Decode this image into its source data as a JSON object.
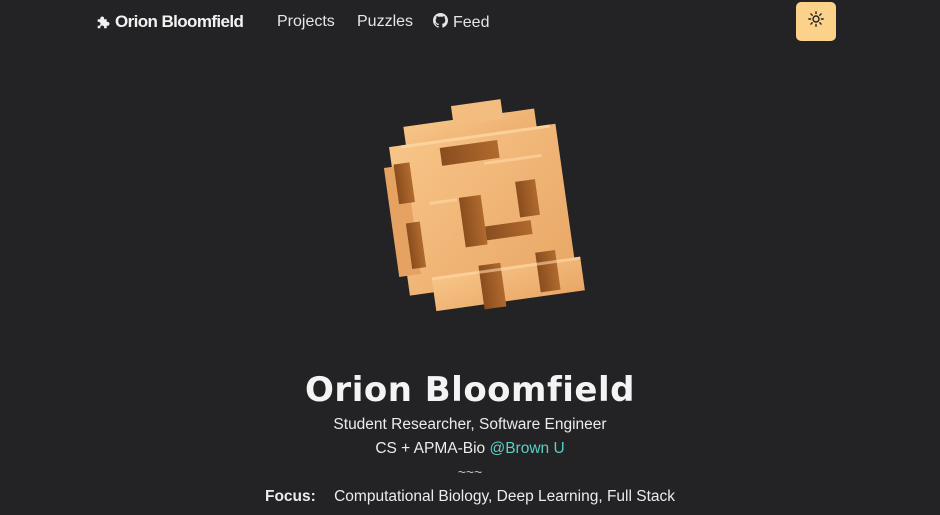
{
  "nav": {
    "brand": "Orion Bloomfield",
    "links": [
      {
        "label": "Projects"
      },
      {
        "label": "Puzzles"
      },
      {
        "label": "Feed",
        "icon": "github-icon"
      }
    ],
    "theme_toggle_icon": "sun-icon",
    "theme_toggle_color": "#fcd28a"
  },
  "hero": {
    "image_icon": "wooden-burr-puzzle",
    "name": "Orion Bloomfield",
    "subtitle": "Student Researcher, Software Engineer",
    "affiliation_prefix": "CS + APMA-Bio",
    "affiliation_link": "@Brown U",
    "divider": "~~~",
    "focus_label": "Focus:",
    "focus_value": "Computational Biology, Deep Learning, Full Stack"
  },
  "colors": {
    "background": "#232224",
    "link": "#5ad1c4",
    "wood_light": "#f0b777",
    "wood_dark": "#9a5a25"
  }
}
